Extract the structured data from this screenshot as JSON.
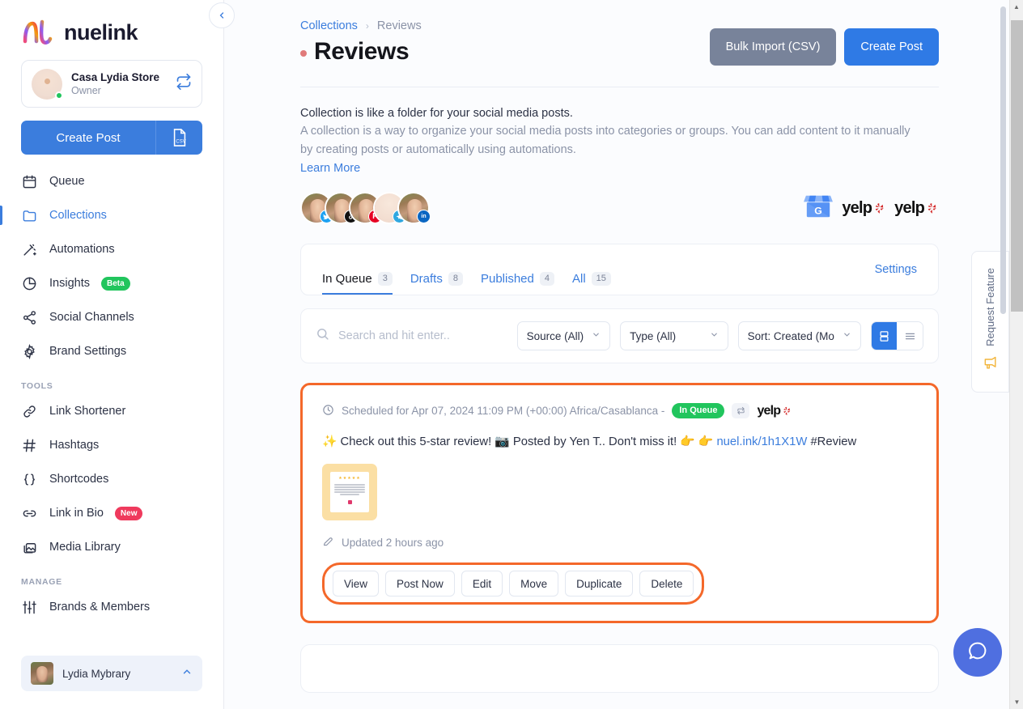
{
  "sidebar": {
    "logo_text": "nuelink",
    "brand": {
      "name": "Casa Lydia Store",
      "role": "Owner",
      "switch_icon": "switch-icon",
      "status": "online"
    },
    "create_post_label": "Create Post",
    "csv_icon": "csv-file-icon",
    "nav": [
      {
        "label": "Queue",
        "icon": "calendar-icon",
        "active": false
      },
      {
        "label": "Collections",
        "icon": "folder-icon",
        "active": true
      },
      {
        "label": "Automations",
        "icon": "magic-wand-icon",
        "active": false
      },
      {
        "label": "Insights",
        "icon": "pie-chart-icon",
        "active": false,
        "badge": "Beta",
        "badge_kind": "beta"
      },
      {
        "label": "Social Channels",
        "icon": "share-nodes-icon",
        "active": false
      },
      {
        "label": "Brand Settings",
        "icon": "gear-icon",
        "active": false
      }
    ],
    "tools_section": "TOOLS",
    "tools": [
      {
        "label": "Link Shortener",
        "icon": "link-icon"
      },
      {
        "label": "Hashtags",
        "icon": "hashtag-icon"
      },
      {
        "label": "Shortcodes",
        "icon": "braces-icon"
      },
      {
        "label": "Link in Bio",
        "icon": "chain-link-icon",
        "badge": "New",
        "badge_kind": "new"
      },
      {
        "label": "Media Library",
        "icon": "images-icon"
      }
    ],
    "manage_section": "MANAGE",
    "manage": [
      {
        "label": "Brands & Members",
        "icon": "sliders-icon"
      }
    ],
    "user": {
      "name": "Lydia Mybrary",
      "chevron": "chevron-up-icon"
    },
    "collapse_icon": "chevron-left-icon"
  },
  "header": {
    "breadcrumb": {
      "parent": "Collections",
      "separator": "›",
      "current": "Reviews"
    },
    "title": "Reviews",
    "title_dot_color": "#e07a7a",
    "bulk_import_label": "Bulk Import (CSV)",
    "create_post_label": "Create Post"
  },
  "intro": {
    "line1": "Collection is like a folder for your social media posts.",
    "line2": "A collection is a way to organize your social media posts into categories or groups. You can add content to it manually by creating posts or automatically using automations.",
    "learn_more": "Learn More"
  },
  "channels": {
    "avatars": [
      {
        "badge_icon": "twitter-icon",
        "badge_color": "#1da1f2",
        "glyph": "✓"
      },
      {
        "badge_icon": "tiktok-icon",
        "badge_color": "#111111",
        "glyph": "♪"
      },
      {
        "badge_icon": "pinterest-icon",
        "badge_color": "#e60023",
        "glyph": "P"
      },
      {
        "badge_icon": "telegram-icon",
        "badge_color": "#2fa7e0",
        "glyph": "➤",
        "brand_avatar": true
      },
      {
        "badge_icon": "linkedin-icon",
        "badge_color": "#0a66c2",
        "glyph": "in"
      }
    ],
    "sources": [
      {
        "name": "google-business-icon",
        "label": "G"
      },
      {
        "name": "yelp-icon",
        "label": "yelp"
      },
      {
        "name": "yelp-icon",
        "label": "yelp"
      }
    ]
  },
  "tabs": {
    "items": [
      {
        "label": "In Queue",
        "count": "3",
        "active": true
      },
      {
        "label": "Drafts",
        "count": "8",
        "active": false
      },
      {
        "label": "Published",
        "count": "4",
        "active": false
      },
      {
        "label": "All",
        "count": "15",
        "active": false
      }
    ],
    "settings_label": "Settings"
  },
  "filters": {
    "search_placeholder": "Search and hit enter..",
    "search_value": "",
    "search_icon": "search-icon",
    "source_select": "Source (All)",
    "type_select": "Type (All)",
    "sort_select": "Sort: Created (Mo",
    "view_grid_icon": "grid-view-icon",
    "view_list_icon": "list-view-icon",
    "active_view": "grid"
  },
  "post": {
    "clock_icon": "clock-icon",
    "schedule_text": "Scheduled for Apr 07, 2024 11:09 PM (+00:00) Africa/Casablanca -",
    "status": "In Queue",
    "recurring_icon": "recurring-icon",
    "platform": "yelp",
    "text_prefix": "✨ Check out this 5-star review! 📷 Posted by Yen T.. Don't miss it! 👉 👉 ",
    "link": "nuel.ink/1h1X1W",
    "text_suffix": " #Review",
    "thumbnail_alt": "review-card-thumbnail",
    "updated_icon": "edit-icon",
    "updated_text": "Updated 2 hours ago",
    "actions": [
      "View",
      "Post Now",
      "Edit",
      "Move",
      "Duplicate",
      "Delete"
    ],
    "highlight_color": "#f4682a"
  },
  "rail": {
    "request_feature_label": "Request Feature",
    "request_feature_icon": "megaphone-icon",
    "help_icon": "chat-bubble-icon"
  },
  "scrollbar": {
    "up_arrow": "▲",
    "down_arrow": "▼"
  }
}
